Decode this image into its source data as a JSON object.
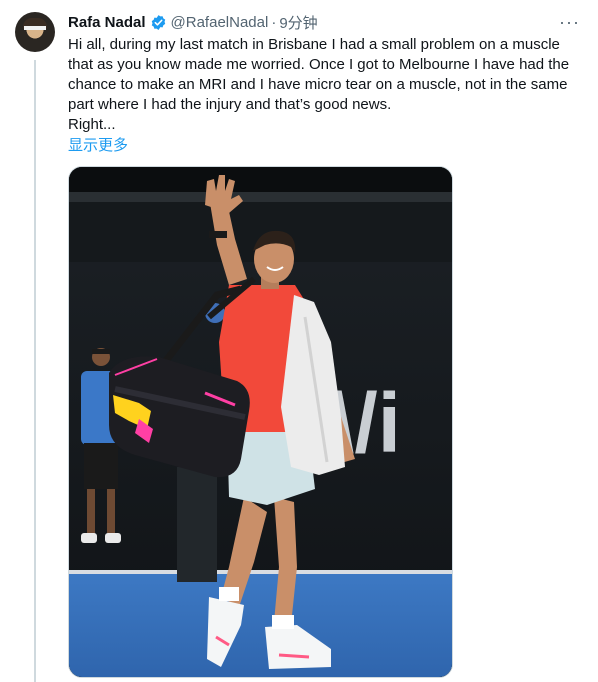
{
  "tweet": {
    "author_name": "Rafa Nadal",
    "handle": "@RafaelNadal",
    "separator": "·",
    "time": "9分钟",
    "more_label": "···",
    "text": "Hi all, during my last match in Brisbane I had a small problem on a muscle that as you know made me worried. Once I got to Melbourne I have had the chance to make an MRI and I have micro tear on a muscle, not in the same part where I had the injury and that’s good news.\nRight...",
    "show_more": "显示更多"
  },
  "media": {
    "wall_text": "\\/i"
  },
  "icons": {
    "verified": "verified-badge-icon",
    "more": "more-options-icon",
    "avatar": "avatar"
  },
  "colors": {
    "accent": "#1d9bf0",
    "secondary_text": "#536471"
  }
}
